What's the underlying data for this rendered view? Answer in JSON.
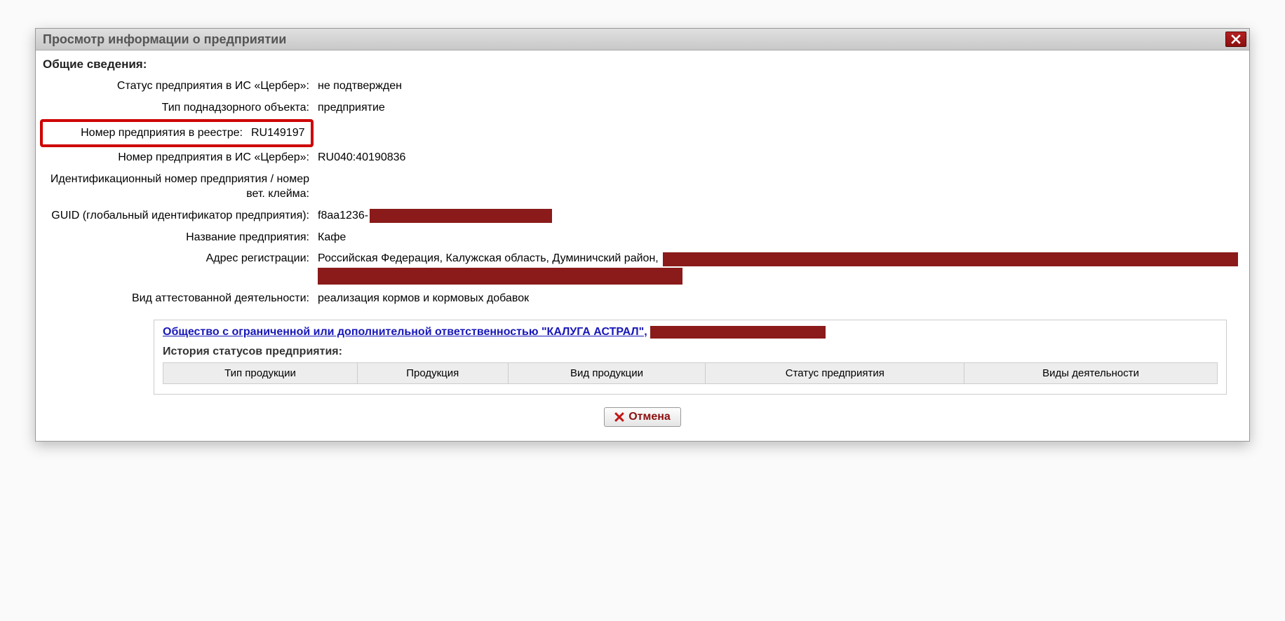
{
  "dialog": {
    "title": "Просмотр информации о предприятии",
    "section_title": "Общие сведения:",
    "fields": {
      "status_label": "Статус предприятия в ИС «Цербер»:",
      "status_value": "не подтвержден",
      "type_label": "Тип поднадзорного объекта:",
      "type_value": "предприятие",
      "reg_num_label": "Номер предприятия в реестре:",
      "reg_num_value": "RU149197",
      "cerber_num_label": "Номер предприятия в ИС «Цербер»:",
      "cerber_num_value": "RU040:40190836",
      "ident_label": "Идентификационный номер предприятия / номер вет. клейма:",
      "ident_value": "",
      "guid_label": "GUID (глобальный идентификатор предприятия):",
      "guid_value_prefix": "f8aa1236-",
      "name_label": "Название предприятия:",
      "name_value": "Кафе",
      "address_label": "Адрес регистрации:",
      "address_value": "Российская Федерация, Калужская область, Думиничский район,",
      "activity_label": "Вид аттестованной деятельности:",
      "activity_value": "реализация кормов и кормовых добавок"
    },
    "company_link": "Общество с ограниченной или дополнительной ответственностью \"КАЛУГА АСТРАЛ\",",
    "history_title": "История статусов предприятия:",
    "history_columns": [
      "Тип продукции",
      "Продукция",
      "Вид продукции",
      "Статус предприятия",
      "Виды деятельности"
    ],
    "cancel_label": "Отмена"
  }
}
